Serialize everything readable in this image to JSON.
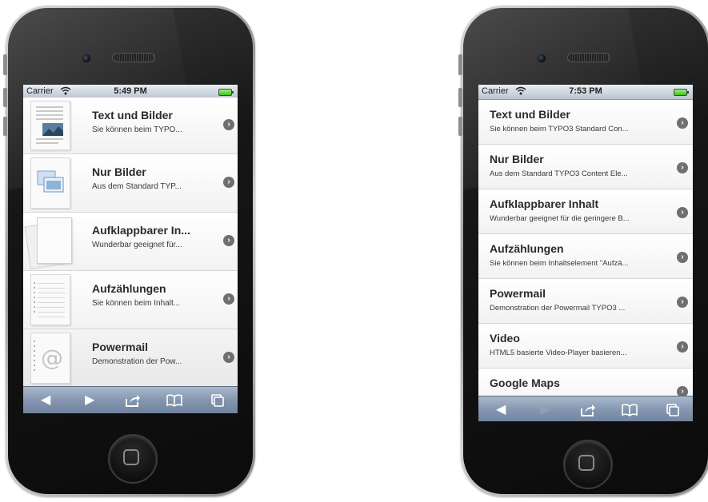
{
  "phones": [
    {
      "status": {
        "carrier": "Carrier",
        "time": "5:49 PM"
      },
      "items": [
        {
          "title": "Text und Bilder",
          "subtitle": "Sie können beim TYPO...",
          "thumb": "text-image-thumb"
        },
        {
          "title": "Nur Bilder",
          "subtitle": "Aus dem Standard TYP...",
          "thumb": "images-thumb"
        },
        {
          "title": "Aufklappbarer In...",
          "subtitle": "Wunderbar geeignet für...",
          "thumb": "paper-stack-thumb"
        },
        {
          "title": "Aufzählungen",
          "subtitle": "Sie können beim Inhalt...",
          "thumb": "list-page-thumb"
        },
        {
          "title": "Powermail",
          "subtitle": "Demonstration der Pow...",
          "thumb": "at-sign-thumb"
        }
      ],
      "toolbar": {
        "back_enabled": true,
        "forward_enabled": true
      }
    },
    {
      "status": {
        "carrier": "Carrier",
        "time": "7:53 PM"
      },
      "items": [
        {
          "title": "Text und Bilder",
          "subtitle": "Sie können beim TYPO3 Standard Con..."
        },
        {
          "title": "Nur Bilder",
          "subtitle": "Aus dem Standard TYPO3 Content Ele..."
        },
        {
          "title": "Aufklappbarer Inhalt",
          "subtitle": "Wunderbar geeignet für die geringere B..."
        },
        {
          "title": "Aufzählungen",
          "subtitle": "Sie können beim Inhaltselement \"Aufzä..."
        },
        {
          "title": "Powermail",
          "subtitle": "Demonstration der Powermail TYPO3 ..."
        },
        {
          "title": "Video",
          "subtitle": "HTML5 basierte Video-Player basieren..."
        },
        {
          "title": "Google Maps",
          "subtitle": ""
        }
      ],
      "toolbar": {
        "back_enabled": true,
        "forward_enabled": false
      }
    }
  ],
  "icons": {
    "chevron": "›",
    "back": "◀",
    "forward": "▶",
    "share": "share-icon",
    "bookmarks": "book-icon",
    "tabs": "pages-icon"
  },
  "colors": {
    "toolbar_top": "#a9b8cc",
    "toolbar_bottom": "#6d809c",
    "statusbar": "#c9d1d9",
    "battery": "#3fbf1d",
    "chevron": "#6f6f6f"
  }
}
